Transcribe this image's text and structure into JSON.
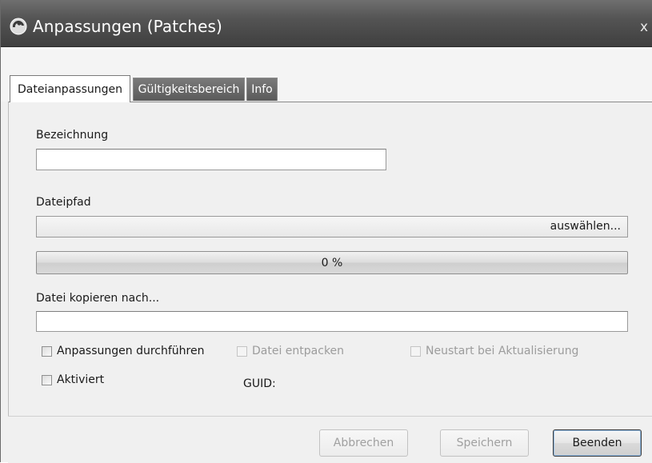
{
  "window": {
    "title": "Anpassungen (Patches)",
    "close_glyph": "x"
  },
  "tabs": [
    {
      "label": "Dateianpassungen",
      "active": true
    },
    {
      "label": "Gültigkeitsbereich",
      "active": false
    },
    {
      "label": "Info",
      "active": false
    }
  ],
  "form": {
    "bezeichnung": {
      "label": "Bezeichnung",
      "value": ""
    },
    "dateipfad": {
      "label": "Dateipfad",
      "value": "",
      "browse_label": "auswählen..."
    },
    "progress": {
      "value": 0,
      "text": "0 %"
    },
    "kopieren_nach": {
      "label": "Datei kopieren nach...",
      "value": ""
    },
    "checkboxes": {
      "anpassungen": {
        "label": "Anpassungen durchführen",
        "checked": false,
        "enabled": true
      },
      "entpacken": {
        "label": "Datei entpacken",
        "checked": false,
        "enabled": false
      },
      "neustart": {
        "label": "Neustart bei Aktualisierung",
        "checked": false,
        "enabled": false
      },
      "aktiviert": {
        "label": "Aktiviert",
        "checked": false,
        "enabled": true
      }
    },
    "guid": {
      "label": "GUID:",
      "value": ""
    }
  },
  "buttons": {
    "abbrechen": "Abbrechen",
    "speichern": "Speichern",
    "beenden": "Beenden"
  },
  "colors": {
    "titlebar": "#545454",
    "active_tab": "#ffffff",
    "inactive_tab": "#6a6a6a",
    "panel": "#f0f0f0"
  }
}
